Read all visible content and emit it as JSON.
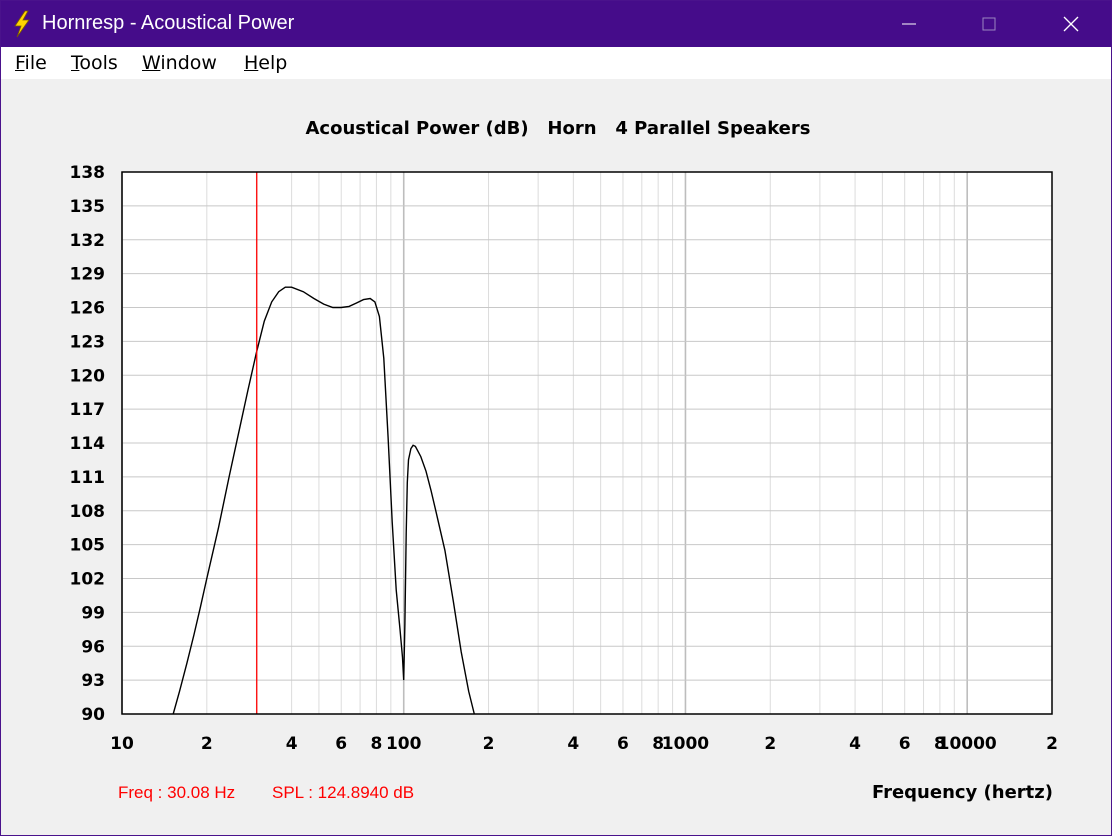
{
  "window": {
    "title": "Hornresp - Acoustical Power",
    "titlebar_color": "#450c8a",
    "icon": "lightning-bolt-icon"
  },
  "menu": {
    "items": [
      {
        "label": "File",
        "accel": "F",
        "rest": "ile"
      },
      {
        "label": "Tools",
        "accel": "T",
        "rest": "ools"
      },
      {
        "label": "Window",
        "accel": "W",
        "rest": "indow"
      },
      {
        "label": "Help",
        "accel": "H",
        "rest": "elp"
      }
    ]
  },
  "chart_data": {
    "type": "line",
    "title": "Acoustical Power (dB)   Horn   4 Parallel Speakers",
    "xlabel": "Frequency (hertz)",
    "ylabel": "",
    "x_scale": "log",
    "xlim": [
      10,
      20000
    ],
    "ylim": [
      90,
      138
    ],
    "grid": true,
    "y_ticks": [
      138,
      135,
      132,
      129,
      126,
      123,
      120,
      117,
      114,
      111,
      108,
      105,
      102,
      99,
      96,
      93,
      90
    ],
    "x_tick_labels": [
      {
        "value": 10,
        "label": "10"
      },
      {
        "value": 20,
        "label": "2"
      },
      {
        "value": 40,
        "label": "4"
      },
      {
        "value": 60,
        "label": "6"
      },
      {
        "value": 80,
        "label": "8"
      },
      {
        "value": 100,
        "label": "100"
      },
      {
        "value": 200,
        "label": "2"
      },
      {
        "value": 400,
        "label": "4"
      },
      {
        "value": 600,
        "label": "6"
      },
      {
        "value": 800,
        "label": "8"
      },
      {
        "value": 1000,
        "label": "1000"
      },
      {
        "value": 2000,
        "label": "2"
      },
      {
        "value": 4000,
        "label": "4"
      },
      {
        "value": 6000,
        "label": "6"
      },
      {
        "value": 8000,
        "label": "8"
      },
      {
        "value": 10000,
        "label": "10000"
      },
      {
        "value": 20000,
        "label": "2"
      }
    ],
    "series": [
      {
        "color": "#000000",
        "x": [
          15.2,
          16,
          17,
          18,
          19,
          20,
          22,
          24,
          26,
          28,
          30,
          32,
          34,
          36,
          38,
          40,
          44,
          48,
          52,
          56,
          60,
          64,
          68,
          72,
          76,
          79,
          82,
          85,
          88,
          91,
          94,
          97,
          99,
          100,
          101,
          102,
          103,
          104,
          106,
          108,
          110,
          115,
          120,
          125,
          130,
          140,
          150,
          160,
          170,
          178
        ],
        "y": [
          90,
          92,
          94.5,
          97,
          99.5,
          102,
          106.5,
          111,
          115,
          118.7,
          122,
          124.8,
          126.5,
          127.4,
          127.8,
          127.8,
          127.4,
          126.8,
          126.3,
          126.0,
          126.0,
          126.1,
          126.4,
          126.7,
          126.8,
          126.5,
          125.2,
          121.5,
          114.5,
          107.0,
          101.0,
          97.5,
          95.0,
          93.0,
          98.0,
          106.0,
          110.5,
          112.5,
          113.5,
          113.8,
          113.7,
          112.8,
          111.5,
          109.8,
          108.0,
          104.5,
          100.0,
          95.5,
          92.0,
          90.0
        ]
      }
    ],
    "marker": {
      "freq": 30.08,
      "color": "#ff0000"
    }
  },
  "readout": {
    "freq": "Freq : 30.08 Hz",
    "spl": "SPL : 124.8940 dB",
    "color": "#ff0000"
  }
}
